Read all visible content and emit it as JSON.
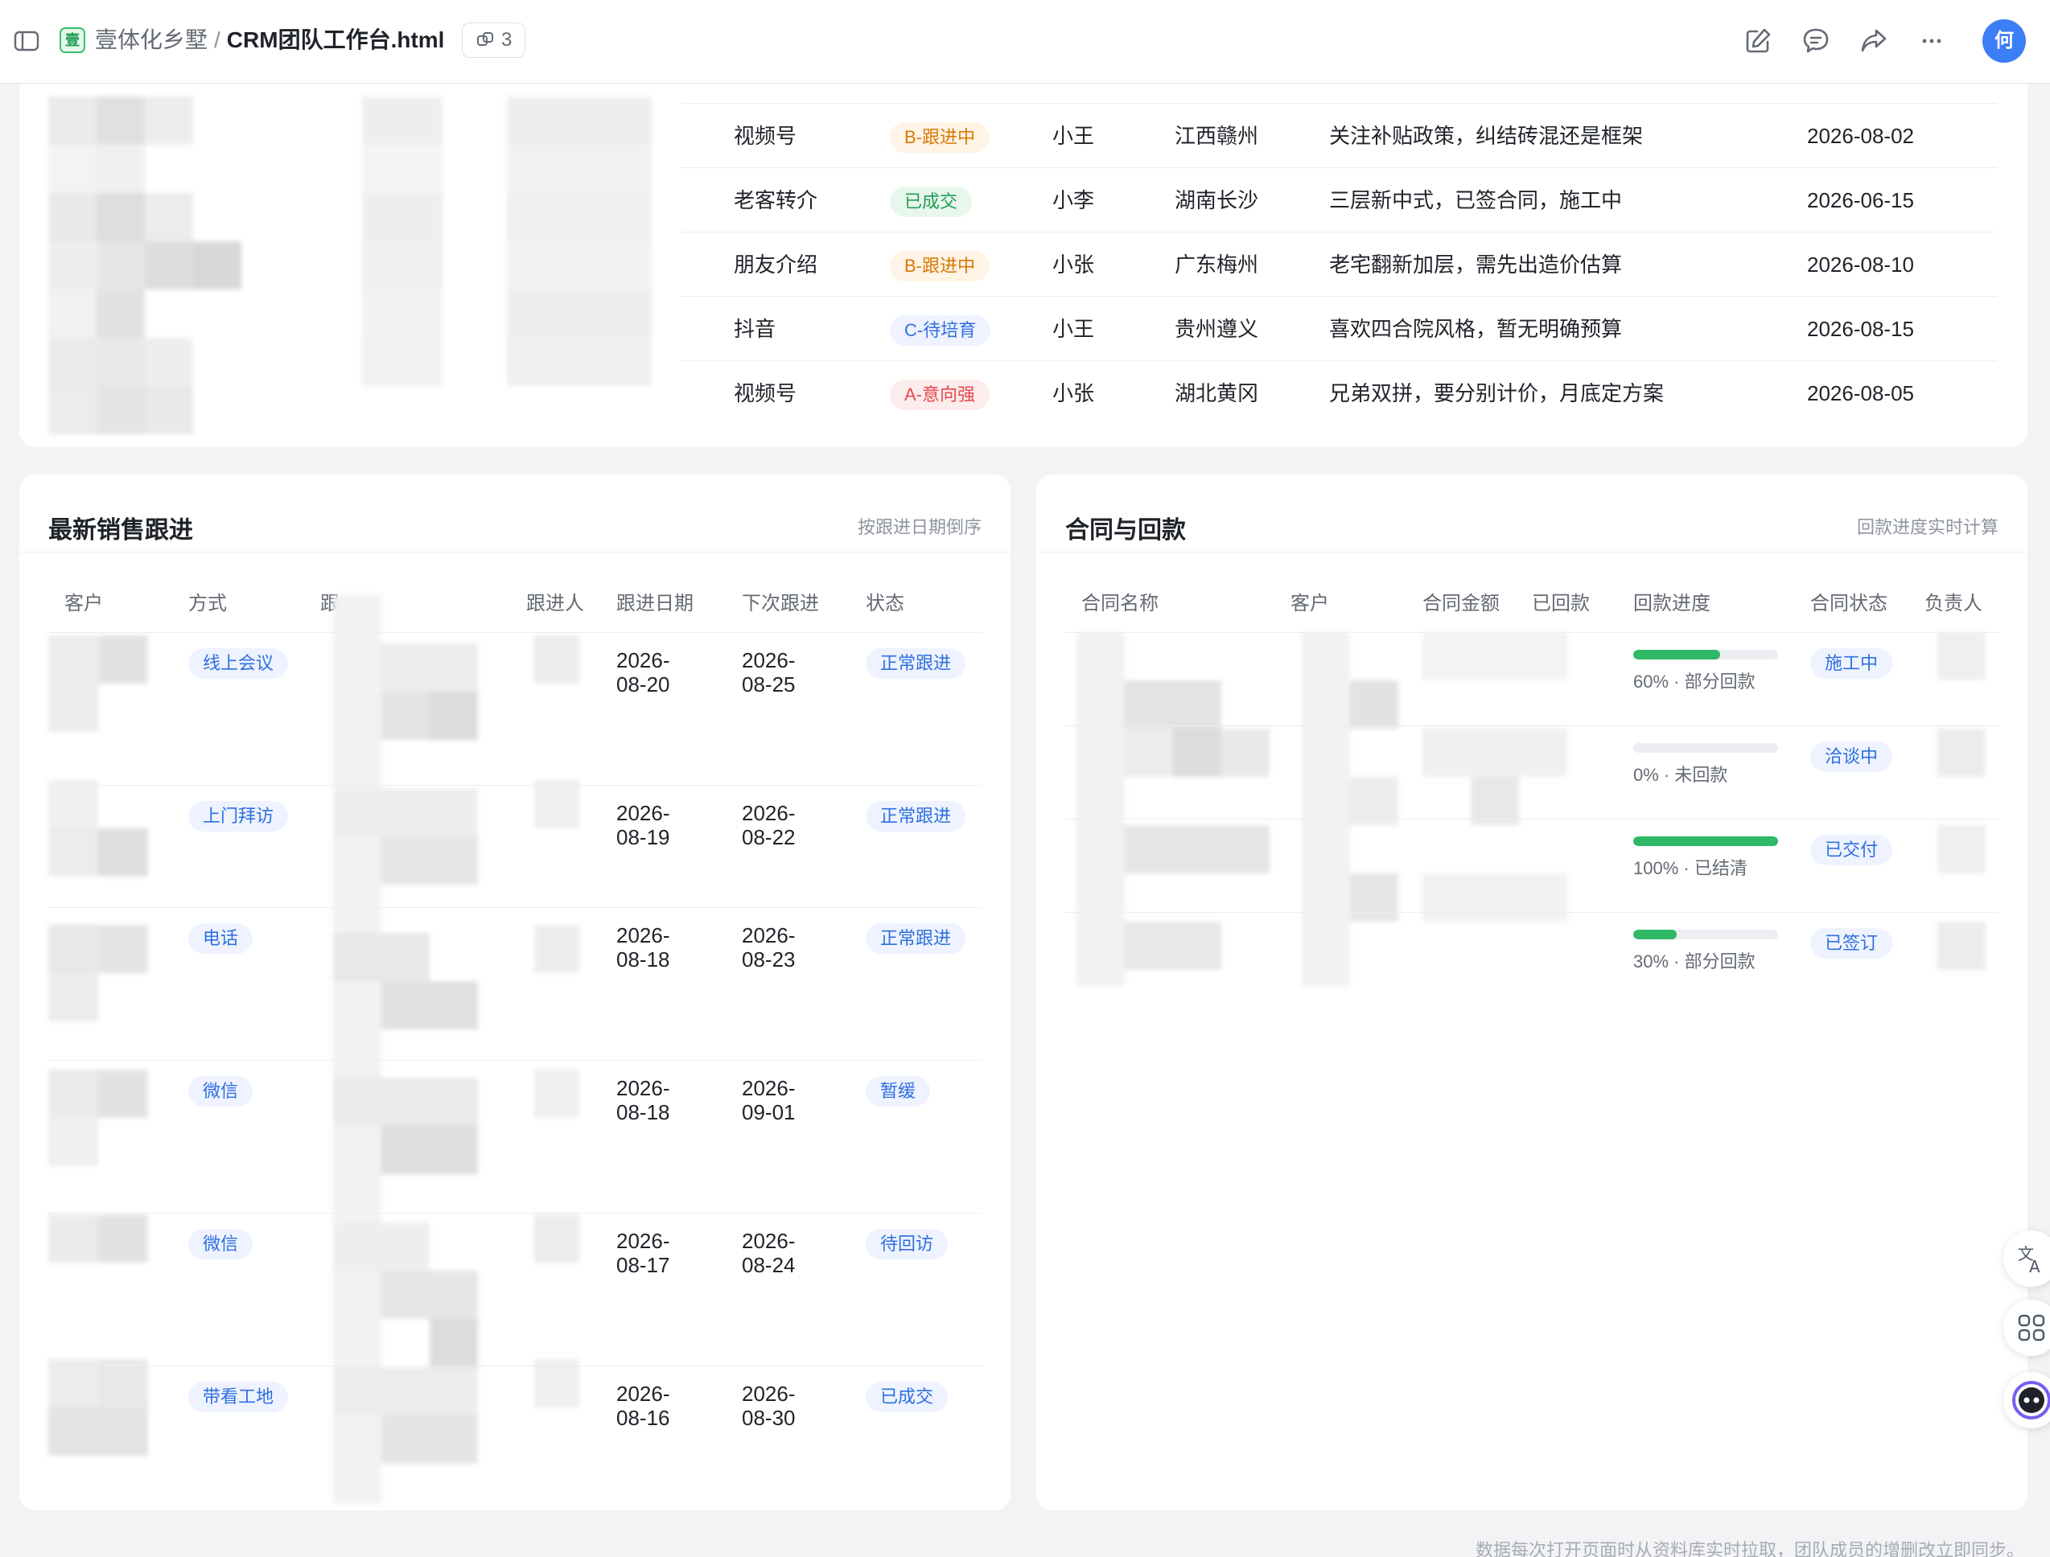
{
  "topbar": {
    "space_icon": "壹",
    "space_name": "壹体化乡墅",
    "separator": "/",
    "file_name": "CRM团队工作台.html",
    "link_count": "3",
    "avatar": "何"
  },
  "leads": {
    "rows": [
      {
        "source": "视频号",
        "grade": "B-跟进中",
        "grade_type": "b",
        "owner": "小王",
        "region": "江西赣州",
        "note": "关注补贴政策，纠结砖混还是框架",
        "date": "2026-08-02"
      },
      {
        "source": "老客转介",
        "grade": "已成交",
        "grade_type": "done",
        "owner": "小李",
        "region": "湖南长沙",
        "note": "三层新中式，已签合同，施工中",
        "date": "2026-06-15"
      },
      {
        "source": "朋友介绍",
        "grade": "B-跟进中",
        "grade_type": "b",
        "owner": "小张",
        "region": "广东梅州",
        "note": "老宅翻新加层，需先出造价估算",
        "date": "2026-08-10"
      },
      {
        "source": "抖音",
        "grade": "C-待培育",
        "grade_type": "c",
        "owner": "小王",
        "region": "贵州遵义",
        "note": "喜欢四合院风格，暂无明确预算",
        "date": "2026-08-15"
      },
      {
        "source": "视频号",
        "grade": "A-意向强",
        "grade_type": "a",
        "owner": "小张",
        "region": "湖北黄冈",
        "note": "兄弟双拼，要分别计价，月底定方案",
        "date": "2026-08-05"
      }
    ]
  },
  "followups": {
    "title": "最新销售跟进",
    "subtitle": "按跟进日期倒序",
    "headers": {
      "customer": "客户",
      "method": "方式",
      "content": "跟",
      "owner": "跟进人",
      "date": "跟进日期",
      "next": "下次跟进",
      "status": "状态"
    },
    "rows": [
      {
        "method": "线上会议",
        "date_y": "2026-",
        "date_md": "08-20",
        "next_y": "2026-",
        "next_md": "08-25",
        "status": "正常跟进"
      },
      {
        "method": "上门拜访",
        "date_y": "2026-",
        "date_md": "08-19",
        "next_y": "2026-",
        "next_md": "08-22",
        "status": "正常跟进"
      },
      {
        "method": "电话",
        "date_y": "2026-",
        "date_md": "08-18",
        "next_y": "2026-",
        "next_md": "08-23",
        "status": "正常跟进"
      },
      {
        "method": "微信",
        "date_y": "2026-",
        "date_md": "08-18",
        "next_y": "2026-",
        "next_md": "09-01",
        "status": "暂缓"
      },
      {
        "method": "微信",
        "date_y": "2026-",
        "date_md": "08-17",
        "next_y": "2026-",
        "next_md": "08-24",
        "status": "待回访"
      },
      {
        "method": "带看工地",
        "date_y": "2026-",
        "date_md": "08-16",
        "next_y": "2026-",
        "next_md": "08-30",
        "status": "已成交"
      }
    ]
  },
  "contracts": {
    "title": "合同与回款",
    "subtitle": "回款进度实时计算",
    "headers": {
      "name": "合同名称",
      "customer": "客户",
      "amount": "合同金额",
      "paid": "已回款",
      "progress": "回款进度",
      "status": "合同状态",
      "owner": "负责人"
    },
    "rows": [
      {
        "progress": 0.6,
        "progress_text": "60% · 部分回款",
        "status": "施工中"
      },
      {
        "progress": 0.0,
        "progress_text": "0% · 未回款",
        "status": "洽谈中"
      },
      {
        "progress": 1.0,
        "progress_text": "100% · 已结清",
        "status": "已交付"
      },
      {
        "progress": 0.3,
        "progress_text": "30% · 部分回款",
        "status": "已签订"
      }
    ]
  },
  "footer": {
    "note": "数据每次打开页面时从资料库实时拉取，团队成员的增删改立即同步。"
  },
  "colors": {
    "accent": "#3c7ef6",
    "progress": "#2fb865",
    "page_bg": "#f2f3f5"
  }
}
